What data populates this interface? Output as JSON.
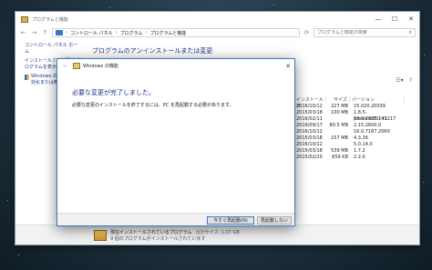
{
  "window": {
    "title": "プログラムと機能",
    "minimize": "—",
    "maximize": "☐",
    "close": "✕"
  },
  "addressbar": {
    "breadcrumb": [
      "コントロール パネル",
      "プログラム",
      "プログラムと機能"
    ],
    "search_placeholder": "プログラムと機能の検索"
  },
  "left_pane": {
    "home": "コントロール パネル ホーム",
    "installed_updates": "インストールされた更新プログラムを表示",
    "windows_features": "Windows の機能の有効化または無効化"
  },
  "content": {
    "heading": "プログラムのアンインストールまたは変更"
  },
  "list": {
    "headers": [
      "インストール日",
      "サイズ",
      "バージョン"
    ],
    "rows": [
      {
        "date": "2016/10/12",
        "size": "227 MB",
        "version": "15.020.20039"
      },
      {
        "date": "2015/03/18",
        "size": "100 MB",
        "version": "1.8.5-preview.20141217"
      },
      {
        "date": "2016/02/11",
        "size": "",
        "version": "53.0.2785.143"
      },
      {
        "date": "2016/09/17",
        "size": "80.5 MB",
        "version": "2.15.2600.0"
      },
      {
        "date": "2016/10/12",
        "size": "",
        "version": "16.0.7167.2060"
      },
      {
        "date": "2015/03/18",
        "size": "157 MB",
        "version": "4.3.26"
      },
      {
        "date": "2016/10/12",
        "size": "",
        "version": "5.0.14.0"
      },
      {
        "date": "2015/03/18",
        "size": "539 MB",
        "version": "1.7.2"
      },
      {
        "date": "2015/02/20",
        "size": "659 KB",
        "version": "2.2.0"
      }
    ]
  },
  "status": {
    "line1": "現在インストールされているプログラム",
    "total_size": "合計サイズ: 1.07 GB",
    "line2": "9 個のプログラムがインストールされています"
  },
  "dialog": {
    "title": "Windows の機能",
    "heading": "必要な変更が完了しました。",
    "message": "必要な変更のインストールを終了するには、PC を再起動する必要があります。",
    "restart_now": "今すぐ再起動(N)",
    "restart_later": "再起動しない",
    "close": "✕"
  }
}
